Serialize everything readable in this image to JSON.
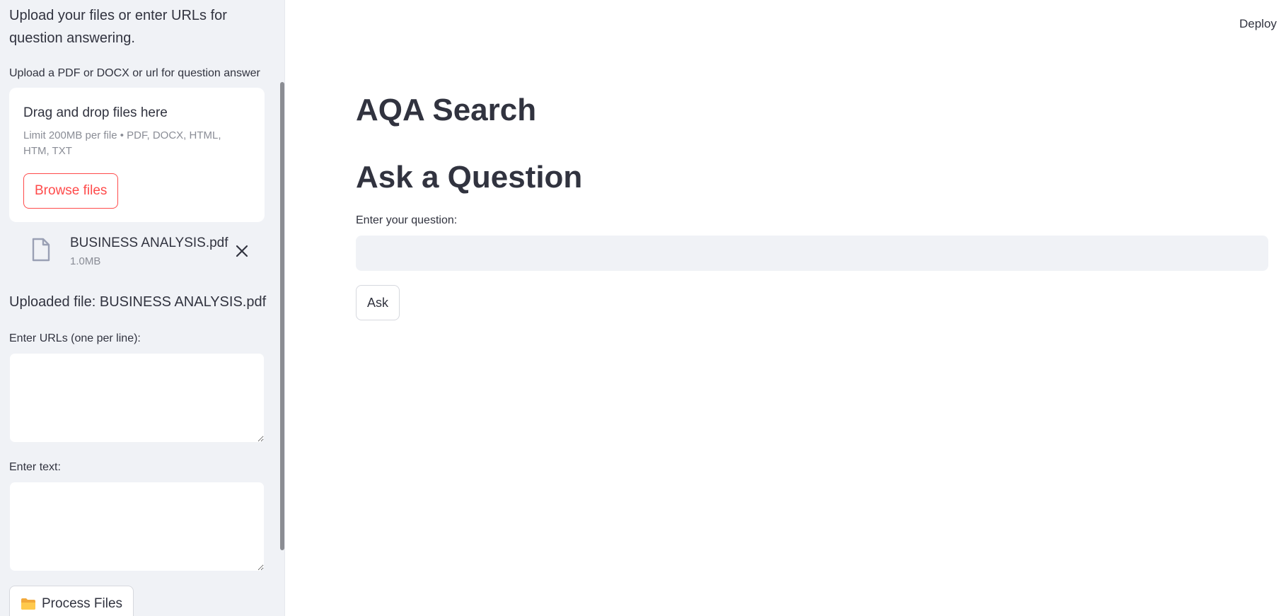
{
  "sidebar": {
    "intro": "Upload your files or enter URLs for question answering.",
    "upload_label": "Upload a PDF or DOCX or url for question answer",
    "dropzone": {
      "title": "Drag and drop files here",
      "limit": "Limit 200MB per file • PDF, DOCX, HTML, HTM, TXT",
      "browse_label": "Browse files"
    },
    "file": {
      "name": "BUSINESS ANALYSIS.pdf",
      "size": "1.0MB",
      "icon": "file-icon",
      "remove_icon": "close-icon"
    },
    "uploaded_message": "Uploaded file: BUSINESS ANALYSIS.pdf",
    "urls_label": "Enter URLs (one per line):",
    "urls_value": "",
    "text_label": "Enter text:",
    "text_value": "",
    "process_label": "Process Files",
    "process_icon": "folder-icon"
  },
  "header": {
    "deploy_label": "Deploy"
  },
  "main": {
    "title": "AQA Search",
    "section_title": "Ask a Question",
    "question_label": "Enter your question:",
    "question_value": "",
    "ask_label": "Ask"
  },
  "colors": {
    "accent": "#ff4b4b",
    "sidebar_bg": "#f0f2f6",
    "text": "#31333f",
    "muted_text": "#8a8d96"
  }
}
